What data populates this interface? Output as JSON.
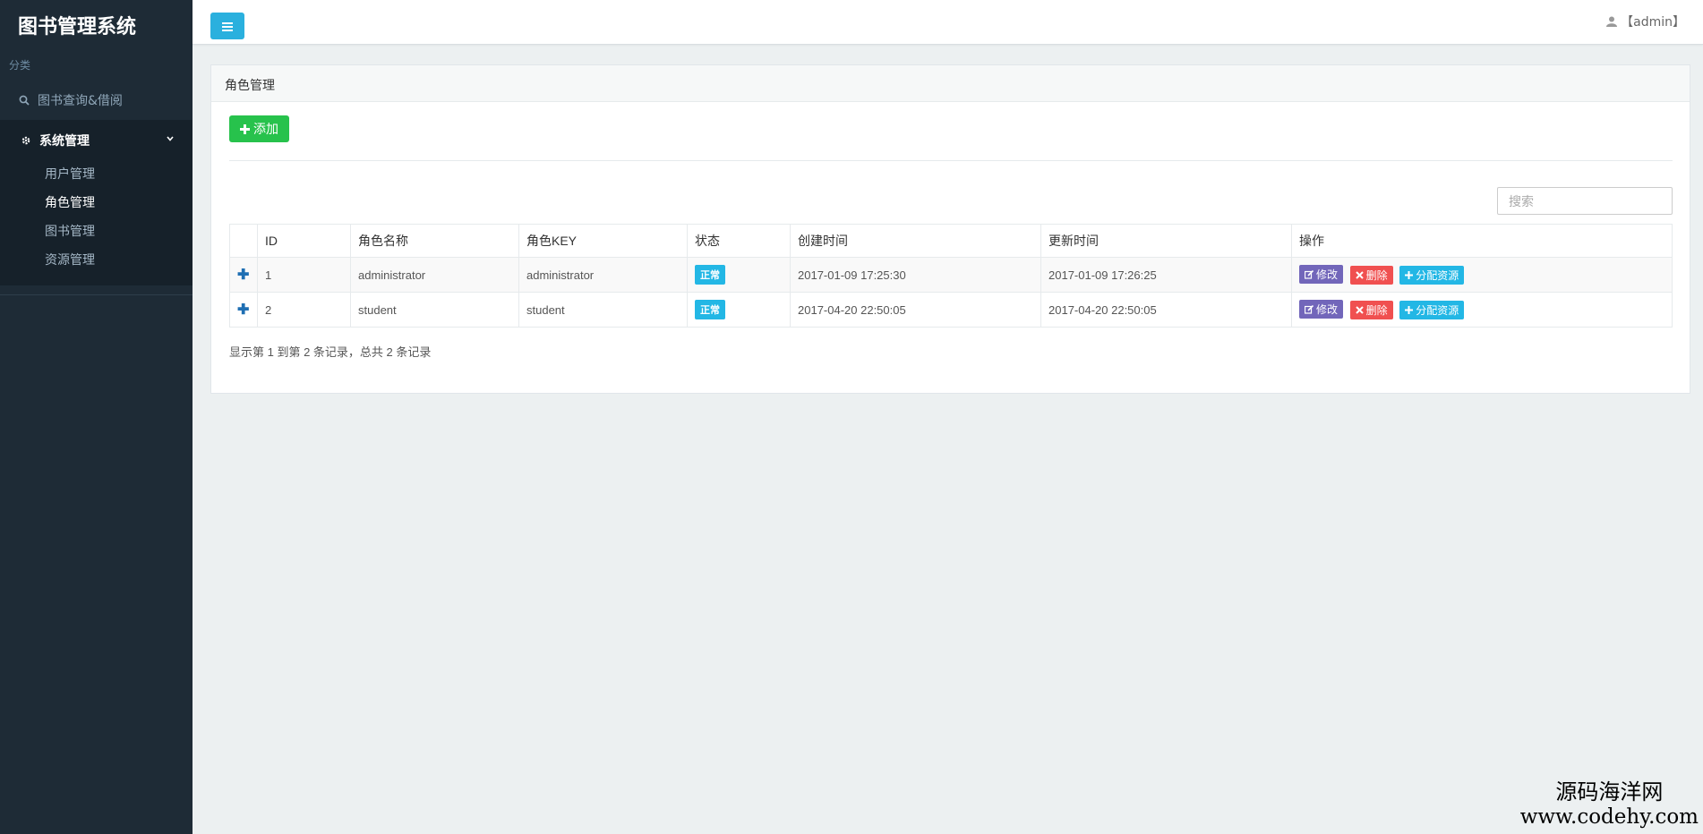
{
  "app": {
    "title": "图书管理系统"
  },
  "sidebar": {
    "section_label": "分类",
    "items": [
      {
        "label": "图书查询&借阅",
        "icon": "search-icon"
      }
    ],
    "group": {
      "label": "系统管理",
      "icon": "gear-icon",
      "expanded": true,
      "children": [
        {
          "label": "用户管理",
          "active": false
        },
        {
          "label": "角色管理",
          "active": true
        },
        {
          "label": "图书管理",
          "active": false
        },
        {
          "label": "资源管理",
          "active": false
        }
      ]
    }
  },
  "topbar": {
    "user_label": "【admin】",
    "user_icon": "user-icon",
    "menu_icon": "hamburger-menu-icon"
  },
  "panel": {
    "title": "角色管理",
    "add_label": "添加",
    "search_placeholder": "搜索",
    "table": {
      "headers": [
        "",
        "ID",
        "角色名称",
        "角色KEY",
        "状态",
        "创建时间",
        "更新时间",
        "操作"
      ],
      "rows": [
        {
          "id": "1",
          "name": "administrator",
          "key": "administrator",
          "status": "正常",
          "created": "2017-01-09 17:25:30",
          "updated": "2017-01-09 17:26:25"
        },
        {
          "id": "2",
          "name": "student",
          "key": "student",
          "status": "正常",
          "created": "2017-04-20 22:50:05",
          "updated": "2017-04-20 22:50:05"
        }
      ],
      "actions": {
        "edit": "修改",
        "delete": "删除",
        "assign": "分配资源"
      }
    },
    "summary": "显示第 1 到第 2 条记录，总共 2 条记录"
  },
  "watermark": {
    "line1": "源码海洋网",
    "line2": "www.codehy.com"
  },
  "colors": {
    "sidebar_bg": "#1e2b36",
    "accent": "#2ab0de",
    "success": "#27c24c",
    "edit": "#7266ba",
    "danger": "#f05050",
    "info": "#23b7e5"
  }
}
